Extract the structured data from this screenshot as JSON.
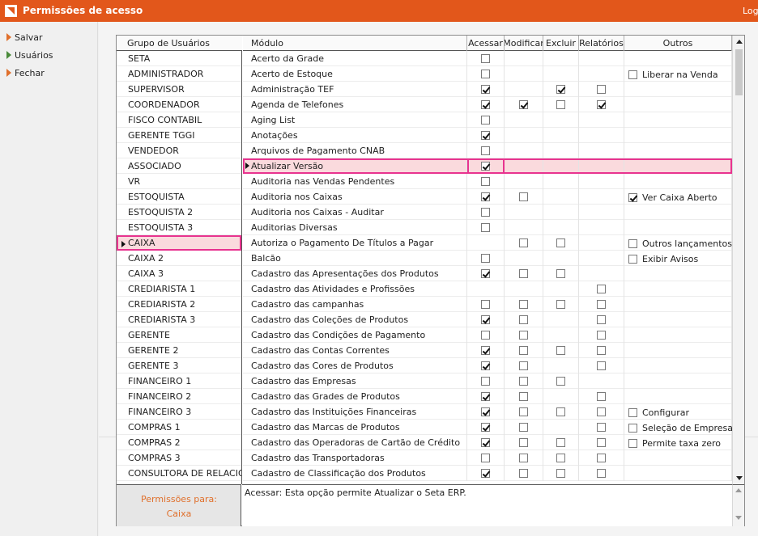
{
  "window": {
    "title": "Permissões de acesso",
    "logout_label": "Log"
  },
  "sidebar": {
    "items": [
      {
        "label": "Salvar",
        "icon": "orange-arrow-icon",
        "color": "#e0702c"
      },
      {
        "label": "Usuários",
        "icon": "green-arrow-icon",
        "color": "#4a8a3a"
      },
      {
        "label": "Fechar",
        "icon": "orange-arrow-icon",
        "color": "#e0702c"
      }
    ]
  },
  "groups": {
    "header": "Grupo de Usuários",
    "selected_index": 12,
    "items": [
      "SETA",
      "ADMINISTRADOR",
      "SUPERVISOR",
      "COORDENADOR",
      "FISCO CONTABIL",
      "GERENTE TGGI",
      "VENDEDOR",
      "ASSOCIADO",
      "VR",
      "ESTOQUISTA",
      "ESTOQUISTA 2",
      "ESTOQUISTA 3",
      "CAIXA",
      "CAIXA 2",
      "CAIXA 3",
      "CREDIARISTA 1",
      "CREDIARISTA 2",
      "CREDIARISTA 3",
      "GERENTE",
      "GERENTE 2",
      "GERENTE 3",
      "FINANCEIRO 1",
      "FINANCEIRO 2",
      "FINANCEIRO 3",
      "COMPRAS 1",
      "COMPRAS 2",
      "COMPRAS 3",
      "CONSULTORA DE RELACIONAMENTO"
    ]
  },
  "modules": {
    "headers": {
      "modulo": "Módulo",
      "acessar": "Acessar",
      "modificar": "Modificar",
      "excluir": "Excluir",
      "relatorios": "Relatórios",
      "outros": "Outros"
    },
    "selected_index": 7,
    "rows": [
      {
        "name": "Acerto da Grade",
        "acessar": false,
        "modificar": null,
        "excluir": null,
        "relatorios": null,
        "outros": []
      },
      {
        "name": "Acerto de Estoque",
        "acessar": false,
        "modificar": null,
        "excluir": null,
        "relatorios": null,
        "outros": [
          {
            "label": "Liberar na Venda",
            "checked": false
          }
        ]
      },
      {
        "name": "Administração TEF",
        "acessar": true,
        "modificar": null,
        "excluir": true,
        "relatorios": false,
        "outros": []
      },
      {
        "name": "Agenda de Telefones",
        "acessar": true,
        "modificar": true,
        "excluir": false,
        "relatorios": true,
        "outros": []
      },
      {
        "name": "Aging List",
        "acessar": false,
        "modificar": null,
        "excluir": null,
        "relatorios": null,
        "outros": []
      },
      {
        "name": "Anotações",
        "acessar": true,
        "modificar": null,
        "excluir": null,
        "relatorios": null,
        "outros": []
      },
      {
        "name": "Arquivos de Pagamento CNAB",
        "acessar": false,
        "modificar": null,
        "excluir": null,
        "relatorios": null,
        "outros": []
      },
      {
        "name": "Atualizar Versão",
        "acessar": true,
        "modificar": null,
        "excluir": null,
        "relatorios": null,
        "outros": []
      },
      {
        "name": "Auditoria nas Vendas Pendentes",
        "acessar": false,
        "modificar": null,
        "excluir": null,
        "relatorios": null,
        "outros": []
      },
      {
        "name": "Auditoria nos Caixas",
        "acessar": true,
        "modificar": false,
        "excluir": null,
        "relatorios": null,
        "outros": [
          {
            "label": "Ver Caixa Aberto",
            "checked": true
          }
        ]
      },
      {
        "name": "Auditoria nos Caixas - Auditar",
        "acessar": false,
        "modificar": null,
        "excluir": null,
        "relatorios": null,
        "outros": []
      },
      {
        "name": "Auditorias Diversas",
        "acessar": false,
        "modificar": null,
        "excluir": null,
        "relatorios": null,
        "outros": []
      },
      {
        "name": "Autoriza o Pagamento De Títulos a Pagar",
        "acessar": null,
        "modificar": false,
        "excluir": false,
        "relatorios": null,
        "outros": [
          {
            "label": "Outros lançamentos",
            "checked": false
          }
        ]
      },
      {
        "name": "Balcão",
        "acessar": false,
        "modificar": null,
        "excluir": null,
        "relatorios": null,
        "outros": [
          {
            "label": "Exibir Avisos",
            "checked": false
          }
        ]
      },
      {
        "name": "Cadastro das Apresentações dos Produtos",
        "acessar": true,
        "modificar": false,
        "excluir": false,
        "relatorios": null,
        "outros": []
      },
      {
        "name": "Cadastro das Atividades e Profissões",
        "acessar": null,
        "modificar": null,
        "excluir": null,
        "relatorios": false,
        "outros": []
      },
      {
        "name": "Cadastro das campanhas",
        "acessar": false,
        "modificar": false,
        "excluir": false,
        "relatorios": false,
        "outros": []
      },
      {
        "name": "Cadastro das Coleções de Produtos",
        "acessar": true,
        "modificar": false,
        "excluir": null,
        "relatorios": false,
        "outros": []
      },
      {
        "name": "Cadastro das Condições de Pagamento",
        "acessar": false,
        "modificar": false,
        "excluir": null,
        "relatorios": false,
        "outros": []
      },
      {
        "name": "Cadastro das Contas Correntes",
        "acessar": true,
        "modificar": false,
        "excluir": false,
        "relatorios": false,
        "outros": []
      },
      {
        "name": "Cadastro das Cores de Produtos",
        "acessar": true,
        "modificar": false,
        "excluir": null,
        "relatorios": false,
        "outros": []
      },
      {
        "name": "Cadastro das Empresas",
        "acessar": false,
        "modificar": false,
        "excluir": false,
        "relatorios": null,
        "outros": []
      },
      {
        "name": "Cadastro das Grades de Produtos",
        "acessar": true,
        "modificar": false,
        "excluir": null,
        "relatorios": false,
        "outros": []
      },
      {
        "name": "Cadastro das Instituições Financeiras",
        "acessar": true,
        "modificar": false,
        "excluir": false,
        "relatorios": false,
        "outros": [
          {
            "label": "Configurar",
            "checked": false
          }
        ]
      },
      {
        "name": "Cadastro das Marcas de Produtos",
        "acessar": true,
        "modificar": false,
        "excluir": null,
        "relatorios": false,
        "outros": [
          {
            "label": "Seleção de Empresas",
            "checked": false
          }
        ]
      },
      {
        "name": "Cadastro das Operadoras de Cartão de Crédito",
        "acessar": true,
        "modificar": false,
        "excluir": false,
        "relatorios": false,
        "outros": [
          {
            "label": "Permite taxa zero",
            "checked": false
          }
        ]
      },
      {
        "name": "Cadastro das Transportadoras",
        "acessar": false,
        "modificar": false,
        "excluir": false,
        "relatorios": false,
        "outros": []
      },
      {
        "name": "Cadastro de Classificação dos Produtos",
        "acessar": true,
        "modificar": false,
        "excluir": false,
        "relatorios": false,
        "outros": []
      }
    ]
  },
  "footer": {
    "permissoes_label": "Permissões para:",
    "permissoes_group": "Caixa",
    "description": "Acessar: Esta opção permite Atualizar o Seta ERP."
  },
  "colors": {
    "accent": "#e2571b",
    "selection_fill": "#fadadd",
    "selection_outline": "#e8338f"
  }
}
